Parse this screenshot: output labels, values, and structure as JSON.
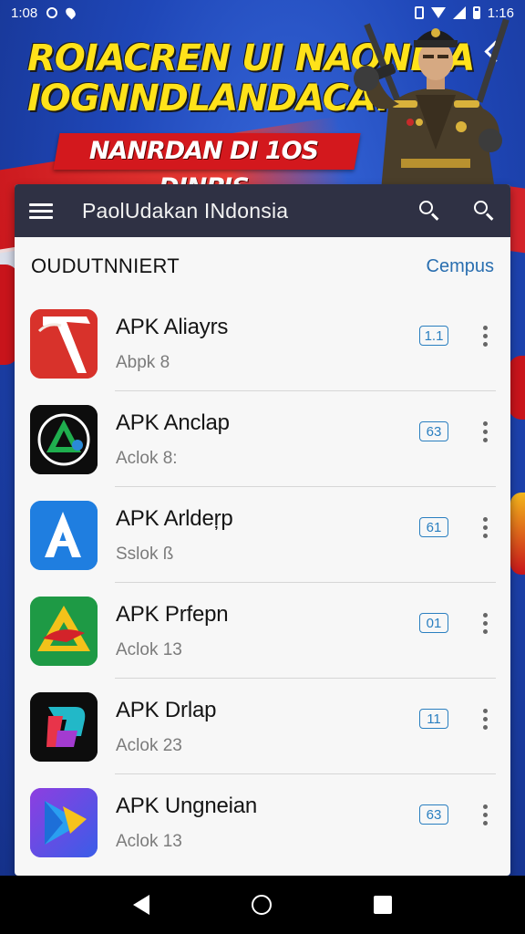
{
  "status_bar": {
    "time_left": "1:08",
    "time_right": "1:16"
  },
  "banner": {
    "headline_line1": "ROIACREN UI NAONEIA",
    "headline_line2": "IOGNNDLANDACA.",
    "subheadline": "NANRDAN DI 1OS DINPIS"
  },
  "app_bar": {
    "title": "PaolUdakan INdonsia"
  },
  "section": {
    "title": "OUDUTNNIERT",
    "link": "Cempus"
  },
  "apps": [
    {
      "name": "APK Aliayrs",
      "sub": "Abpk  8",
      "version": "1.1"
    },
    {
      "name": "APK Anclap",
      "sub": "Aclok  8:",
      "version": "63"
    },
    {
      "name": "APK Arldeŗp",
      "sub": "Sslok  ß",
      "version": "61"
    },
    {
      "name": "APK Prfepn",
      "sub": "Aclok 13",
      "version": "01"
    },
    {
      "name": "APK Drlap",
      "sub": "Aclok 23",
      "version": "11"
    },
    {
      "name": "APK Ungneian",
      "sub": "Aclok 13",
      "version": "63"
    }
  ],
  "icons": {
    "status_left": [
      "notification-circle-icon",
      "location-pin-icon"
    ],
    "status_right": [
      "vibrate-icon",
      "wifi-icon",
      "signal-icon",
      "battery-icon"
    ],
    "app_bar": [
      "hamburger-menu-icon",
      "search-icon",
      "search-icon"
    ],
    "nav": [
      "back-icon",
      "home-icon",
      "recents-icon"
    ]
  },
  "colors": {
    "app_bar_bg": "#2f3144",
    "headline_yellow": "#ffe21a",
    "subheadline_red": "#d3181d",
    "badge_blue": "#2a7fc0",
    "link_blue": "#2a6fb0",
    "banner_blue": "#1f47b8"
  }
}
